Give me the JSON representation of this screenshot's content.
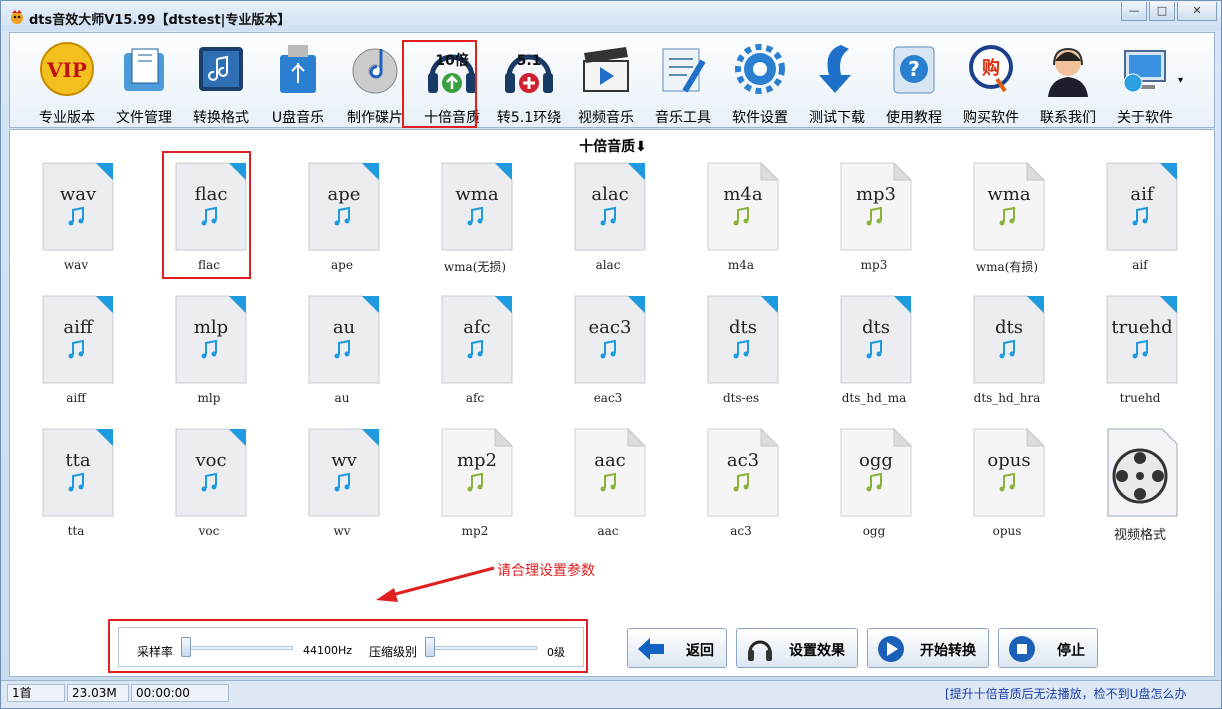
{
  "window": {
    "title": "dts音效大师V15.99【dtstest|专业版本】",
    "min": "—",
    "max": "□",
    "close": "✕"
  },
  "toolbar": {
    "items": [
      {
        "label": "专业版本",
        "icon": "vip-icon"
      },
      {
        "label": "文件管理",
        "icon": "folder-icon"
      },
      {
        "label": "转换格式",
        "icon": "music-convert-icon"
      },
      {
        "label": "U盘音乐",
        "icon": "usb-drive-icon"
      },
      {
        "label": "制作碟片",
        "icon": "cd-music-icon"
      },
      {
        "label": "十倍音质",
        "icon": "headphones-10x-icon",
        "badge": "10倍"
      },
      {
        "label": "转5.1环绕",
        "icon": "headphones-51-icon",
        "badge": "5.1"
      },
      {
        "label": "视频音乐",
        "icon": "clapper-icon"
      },
      {
        "label": "音乐工具",
        "icon": "tools-icon"
      },
      {
        "label": "软件设置",
        "icon": "gear-icon"
      },
      {
        "label": "测试下载",
        "icon": "download-arrow-icon"
      },
      {
        "label": "使用教程",
        "icon": "help-icon"
      },
      {
        "label": "购买软件",
        "icon": "buy-icon",
        "badge": "购"
      },
      {
        "label": "联系我们",
        "icon": "support-agent-icon"
      },
      {
        "label": "关于软件",
        "icon": "computer-globe-icon"
      }
    ],
    "more": "▾"
  },
  "main": {
    "heading": "十倍音质⬇",
    "files": [
      {
        "ext": "wav",
        "cap": "wav",
        "blue": true
      },
      {
        "ext": "flac",
        "cap": "flac",
        "blue": true
      },
      {
        "ext": "ape",
        "cap": "ape",
        "blue": true
      },
      {
        "ext": "wma",
        "cap": "wma(无损)",
        "blue": true
      },
      {
        "ext": "alac",
        "cap": "alac",
        "blue": true
      },
      {
        "ext": "m4a",
        "cap": "m4a",
        "blue": false
      },
      {
        "ext": "mp3",
        "cap": "mp3",
        "blue": false
      },
      {
        "ext": "wma",
        "cap": "wma(有损)",
        "blue": false
      },
      {
        "ext": "aif",
        "cap": "aif",
        "blue": true
      },
      {
        "ext": "aiff",
        "cap": "aiff",
        "blue": true
      },
      {
        "ext": "mlp",
        "cap": "mlp",
        "blue": true
      },
      {
        "ext": "au",
        "cap": "au",
        "blue": true
      },
      {
        "ext": "afc",
        "cap": "afc",
        "blue": true
      },
      {
        "ext": "eac3",
        "cap": "eac3",
        "blue": true
      },
      {
        "ext": "dts",
        "cap": "dts-es",
        "blue": true
      },
      {
        "ext": "dts",
        "cap": "dts_hd_ma",
        "blue": true
      },
      {
        "ext": "dts",
        "cap": "dts_hd_hra",
        "blue": true
      },
      {
        "ext": "truehd",
        "cap": "truehd",
        "blue": true
      },
      {
        "ext": "tta",
        "cap": "tta",
        "blue": true
      },
      {
        "ext": "voc",
        "cap": "voc",
        "blue": true
      },
      {
        "ext": "wv",
        "cap": "wv",
        "blue": true
      },
      {
        "ext": "mp2",
        "cap": "mp2",
        "blue": false
      },
      {
        "ext": "aac",
        "cap": "aac",
        "blue": false
      },
      {
        "ext": "ac3",
        "cap": "ac3",
        "blue": false
      },
      {
        "ext": "ogg",
        "cap": "ogg",
        "blue": false
      },
      {
        "ext": "opus",
        "cap": "opus",
        "blue": false
      },
      {
        "ext": "",
        "cap": "视频格式",
        "video": true
      }
    ],
    "hint": "请合理设置参数"
  },
  "controls": {
    "sample_label": "采样率",
    "sample_value": "44100Hz",
    "sample_level": 0,
    "compress_label": "压缩级别",
    "compress_value": "0级",
    "compress_level": 0
  },
  "buttons": {
    "back": "返回",
    "effects": "设置效果",
    "start": "开始转换",
    "stop": "停止"
  },
  "status": {
    "count": "1首",
    "size": "23.03M",
    "time": "00:00:00",
    "marquee": "[提升十倍音质后无法播放，检不到U盘怎么办"
  },
  "colors": {
    "accent": "#e02020",
    "icon_blue": "#1e9be0",
    "icon_green": "#8ab33a"
  }
}
